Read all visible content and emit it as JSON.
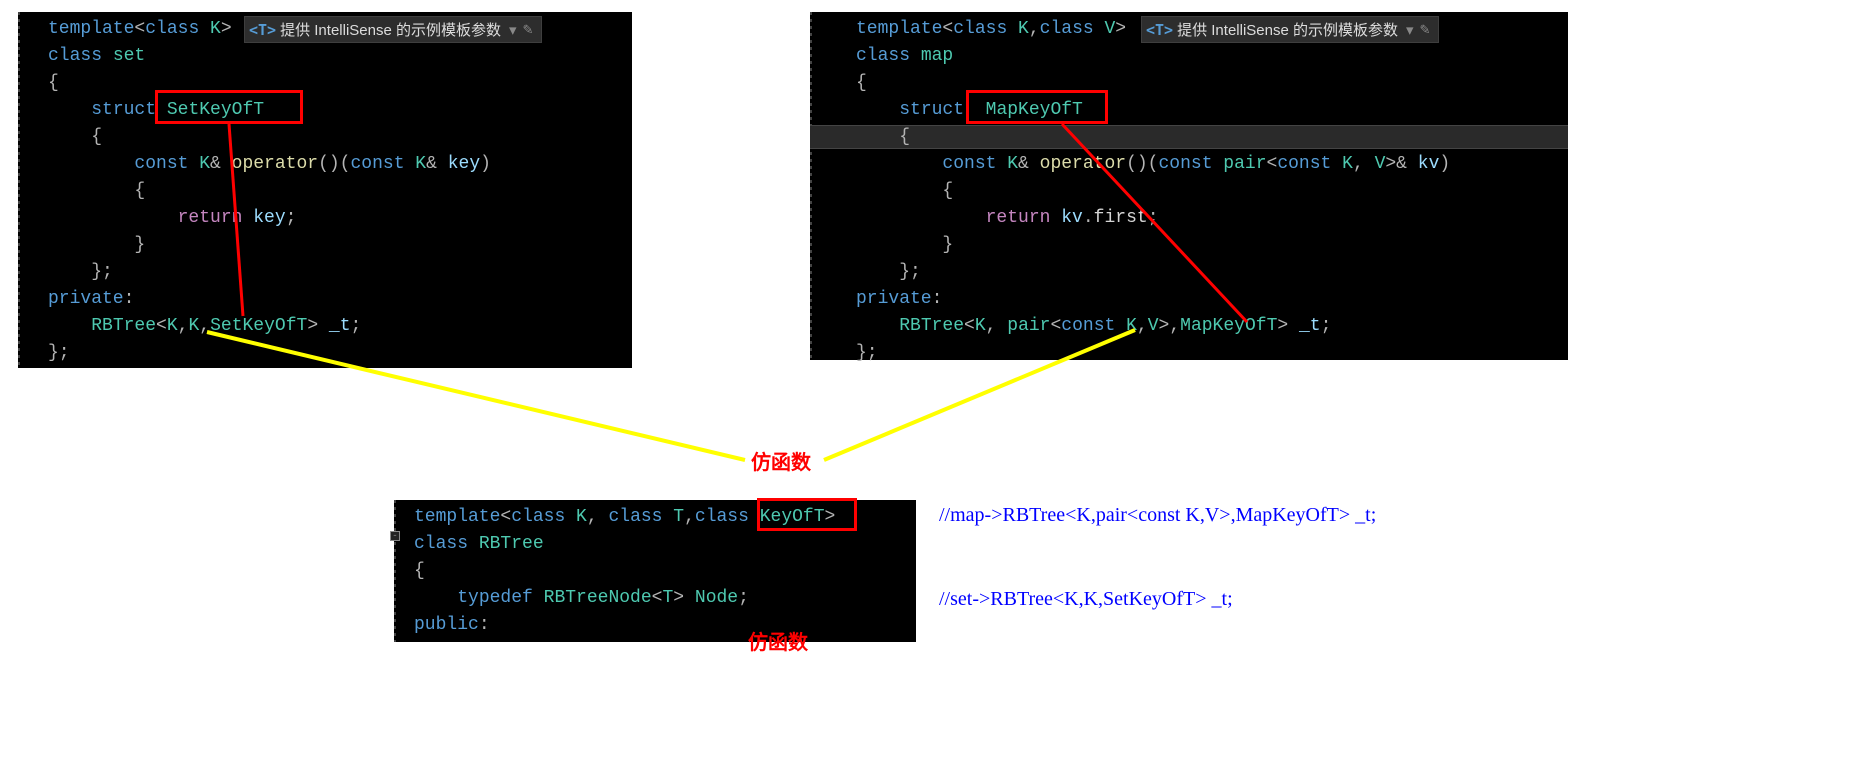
{
  "intellisense_hint": {
    "tag": "<T>",
    "text": "提供 IntelliSense 的示例模板参数",
    "arrow": "▾",
    "pencil": "✎"
  },
  "set_editor": {
    "lines": [
      {
        "tokens": [
          {
            "t": "template",
            "c": "kw-blue"
          },
          {
            "t": "<",
            "c": "op"
          },
          {
            "t": "class ",
            "c": "kw-blue"
          },
          {
            "t": "K",
            "c": "type-teal"
          },
          {
            "t": ">",
            "c": "op"
          }
        ]
      },
      {
        "tokens": [
          {
            "t": "class ",
            "c": "kw-blue"
          },
          {
            "t": "set",
            "c": "type-teal"
          }
        ]
      },
      {
        "tokens": [
          {
            "t": "{",
            "c": "op"
          }
        ]
      },
      {
        "tokens": [
          {
            "t": "    ",
            "c": "plain"
          },
          {
            "t": "struct ",
            "c": "kw-blue"
          },
          {
            "t": "SetKeyOfT",
            "c": "type-teal"
          }
        ]
      },
      {
        "tokens": [
          {
            "t": "    {",
            "c": "op"
          }
        ]
      },
      {
        "tokens": [
          {
            "t": "        ",
            "c": "plain"
          },
          {
            "t": "const ",
            "c": "kw-blue"
          },
          {
            "t": "K",
            "c": "type-teal"
          },
          {
            "t": "& ",
            "c": "op"
          },
          {
            "t": "operator",
            "c": "fn-yellow"
          },
          {
            "t": "()(",
            "c": "op"
          },
          {
            "t": "const ",
            "c": "kw-blue"
          },
          {
            "t": "K",
            "c": "type-teal"
          },
          {
            "t": "& ",
            "c": "op"
          },
          {
            "t": "key",
            "c": "var"
          },
          {
            "t": ")",
            "c": "op"
          }
        ]
      },
      {
        "tokens": [
          {
            "t": "        {",
            "c": "op"
          }
        ]
      },
      {
        "tokens": [
          {
            "t": "            ",
            "c": "plain"
          },
          {
            "t": "return ",
            "c": "pink"
          },
          {
            "t": "key",
            "c": "var"
          },
          {
            "t": ";",
            "c": "op"
          }
        ]
      },
      {
        "tokens": [
          {
            "t": "        }",
            "c": "op"
          }
        ]
      },
      {
        "tokens": [
          {
            "t": "    };",
            "c": "op"
          }
        ]
      },
      {
        "tokens": [
          {
            "t": "private",
            "c": "kw-blue"
          },
          {
            "t": ":",
            "c": "op"
          }
        ]
      },
      {
        "tokens": [
          {
            "t": "    ",
            "c": "plain"
          },
          {
            "t": "RBTree",
            "c": "type-teal"
          },
          {
            "t": "<",
            "c": "op"
          },
          {
            "t": "K",
            "c": "type-teal"
          },
          {
            "t": ",",
            "c": "op"
          },
          {
            "t": "K",
            "c": "type-teal"
          },
          {
            "t": ",",
            "c": "op"
          },
          {
            "t": "SetKeyOfT",
            "c": "type-teal"
          },
          {
            "t": "> ",
            "c": "op"
          },
          {
            "t": "_t",
            "c": "var"
          },
          {
            "t": ";",
            "c": "op"
          }
        ]
      },
      {
        "tokens": [
          {
            "t": "};",
            "c": "op"
          }
        ]
      }
    ]
  },
  "map_editor": {
    "lines": [
      {
        "tokens": [
          {
            "t": "template",
            "c": "kw-blue"
          },
          {
            "t": "<",
            "c": "op"
          },
          {
            "t": "class ",
            "c": "kw-blue"
          },
          {
            "t": "K",
            "c": "type-teal"
          },
          {
            "t": ",",
            "c": "op"
          },
          {
            "t": "class ",
            "c": "kw-blue"
          },
          {
            "t": "V",
            "c": "type-teal"
          },
          {
            "t": ">",
            "c": "op"
          }
        ]
      },
      {
        "tokens": [
          {
            "t": "class ",
            "c": "kw-blue"
          },
          {
            "t": "map",
            "c": "type-teal"
          }
        ]
      },
      {
        "tokens": [
          {
            "t": "{",
            "c": "op"
          }
        ]
      },
      {
        "tokens": [
          {
            "t": "    ",
            "c": "plain"
          },
          {
            "t": "struct  ",
            "c": "kw-blue"
          },
          {
            "t": "MapKeyOfT",
            "c": "type-teal"
          }
        ]
      },
      {
        "tokens": [
          {
            "t": "    {",
            "c": "op"
          }
        ]
      },
      {
        "tokens": [
          {
            "t": "        ",
            "c": "plain"
          },
          {
            "t": "const ",
            "c": "kw-blue"
          },
          {
            "t": "K",
            "c": "type-teal"
          },
          {
            "t": "& ",
            "c": "op"
          },
          {
            "t": "operator",
            "c": "fn-yellow"
          },
          {
            "t": "()(",
            "c": "op"
          },
          {
            "t": "const ",
            "c": "kw-blue"
          },
          {
            "t": "pair",
            "c": "type-teal"
          },
          {
            "t": "<",
            "c": "op"
          },
          {
            "t": "const ",
            "c": "kw-blue"
          },
          {
            "t": "K",
            "c": "type-teal"
          },
          {
            "t": ", ",
            "c": "op"
          },
          {
            "t": "V",
            "c": "type-teal"
          },
          {
            "t": ">& ",
            "c": "op"
          },
          {
            "t": "kv",
            "c": "var"
          },
          {
            "t": ")",
            "c": "op"
          }
        ]
      },
      {
        "tokens": [
          {
            "t": "        {",
            "c": "op"
          }
        ]
      },
      {
        "tokens": [
          {
            "t": "            ",
            "c": "plain"
          },
          {
            "t": "return ",
            "c": "pink"
          },
          {
            "t": "kv",
            "c": "var"
          },
          {
            "t": ".",
            "c": "op"
          },
          {
            "t": "first",
            "c": "plain"
          },
          {
            "t": ";",
            "c": "op"
          }
        ]
      },
      {
        "tokens": [
          {
            "t": "        }",
            "c": "op"
          }
        ]
      },
      {
        "tokens": [
          {
            "t": "    };",
            "c": "op"
          }
        ]
      },
      {
        "tokens": [
          {
            "t": "private",
            "c": "kw-blue"
          },
          {
            "t": ":",
            "c": "op"
          }
        ]
      },
      {
        "tokens": [
          {
            "t": "    ",
            "c": "plain"
          },
          {
            "t": "RBTree",
            "c": "type-teal"
          },
          {
            "t": "<",
            "c": "op"
          },
          {
            "t": "K",
            "c": "type-teal"
          },
          {
            "t": ", ",
            "c": "op"
          },
          {
            "t": "pair",
            "c": "type-teal"
          },
          {
            "t": "<",
            "c": "op"
          },
          {
            "t": "const ",
            "c": "kw-blue"
          },
          {
            "t": "K",
            "c": "type-teal"
          },
          {
            "t": ",",
            "c": "op"
          },
          {
            "t": "V",
            "c": "type-teal"
          },
          {
            "t": ">,",
            "c": "op"
          },
          {
            "t": "MapKeyOfT",
            "c": "type-teal"
          },
          {
            "t": "> ",
            "c": "op"
          },
          {
            "t": "_t",
            "c": "var"
          },
          {
            "t": ";",
            "c": "op"
          }
        ]
      },
      {
        "tokens": [
          {
            "t": "};",
            "c": "op"
          }
        ]
      }
    ]
  },
  "rbtree_editor": {
    "lines": [
      {
        "tokens": [
          {
            "t": "template",
            "c": "kw-blue"
          },
          {
            "t": "<",
            "c": "op"
          },
          {
            "t": "class ",
            "c": "kw-blue"
          },
          {
            "t": "K",
            "c": "type-teal"
          },
          {
            "t": ", ",
            "c": "op"
          },
          {
            "t": "class ",
            "c": "kw-blue"
          },
          {
            "t": "T",
            "c": "type-teal"
          },
          {
            "t": ",",
            "c": "op"
          },
          {
            "t": "class ",
            "c": "kw-blue"
          },
          {
            "t": "KeyOfT",
            "c": "type-teal"
          },
          {
            "t": ">",
            "c": "op"
          }
        ]
      },
      {
        "tokens": [
          {
            "t": "class ",
            "c": "kw-blue"
          },
          {
            "t": "RBTree",
            "c": "type-teal"
          }
        ]
      },
      {
        "tokens": [
          {
            "t": "{",
            "c": "op"
          }
        ]
      },
      {
        "tokens": [
          {
            "t": "    ",
            "c": "plain"
          },
          {
            "t": "typedef ",
            "c": "kw-blue"
          },
          {
            "t": "RBTreeNode",
            "c": "type-teal"
          },
          {
            "t": "<",
            "c": "op"
          },
          {
            "t": "T",
            "c": "type-teal"
          },
          {
            "t": "> ",
            "c": "op"
          },
          {
            "t": "Node",
            "c": "type-teal"
          },
          {
            "t": ";",
            "c": "op"
          }
        ]
      },
      {
        "tokens": [
          {
            "t": "public",
            "c": "kw-blue"
          },
          {
            "t": ":",
            "c": "op"
          }
        ]
      }
    ]
  },
  "annotations": {
    "functor_label_top": "仿函数",
    "functor_label_bottom": "仿函数"
  },
  "comments": {
    "line1": "//map->RBTree<K,pair<const K,V>,MapKeyOfT> _t;",
    "line2": "//set->RBTree<K,K,SetKeyOfT> _t;"
  }
}
